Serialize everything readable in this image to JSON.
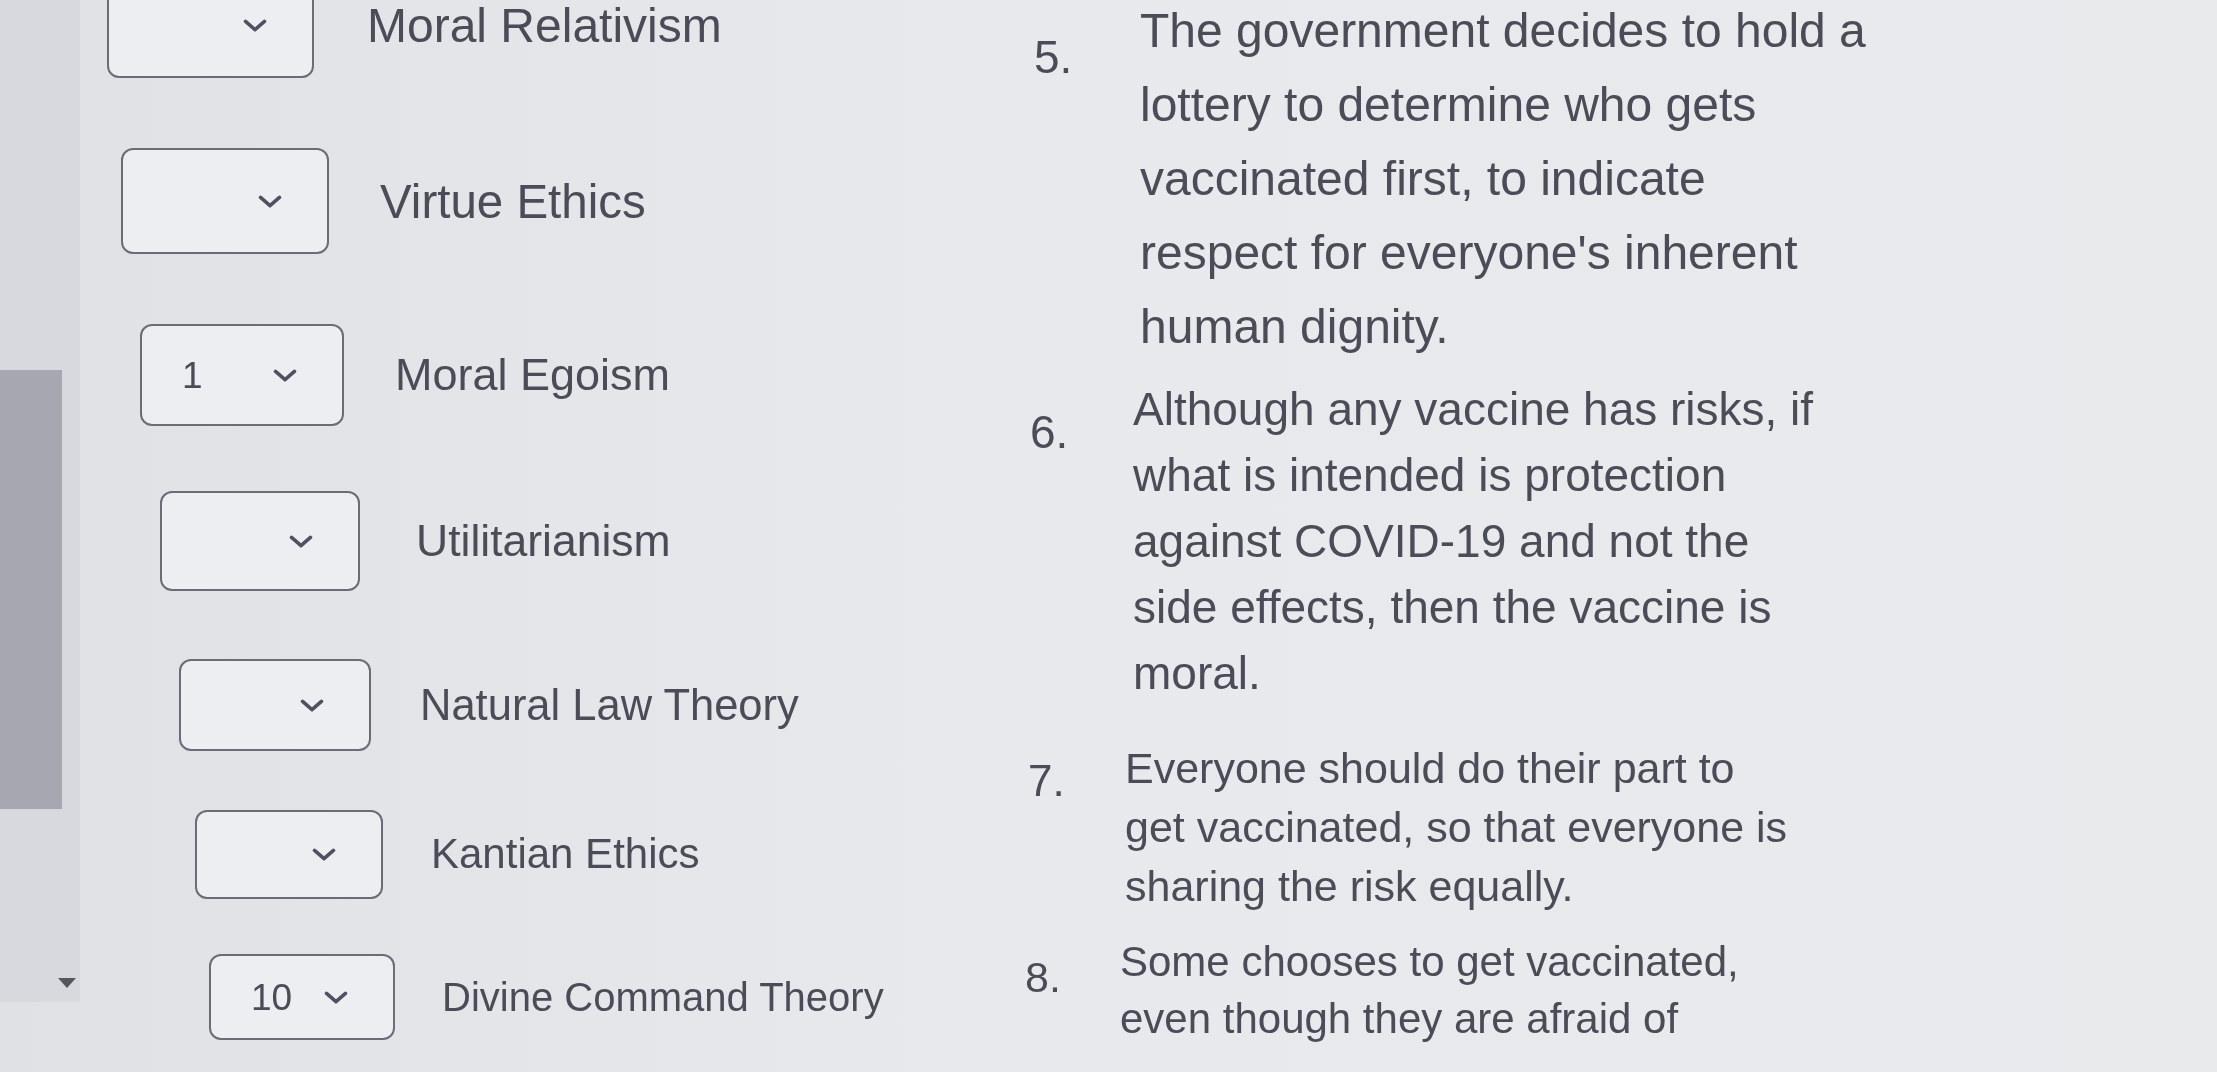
{
  "choices": [
    {
      "label": "Moral Relativism"
    },
    {
      "label": "Virtue Ethics"
    },
    {
      "value": "1",
      "label": "Moral Egoism"
    },
    {
      "label": "Utilitarianism"
    },
    {
      "label": "Natural Law Theory"
    },
    {
      "label": "Kantian Ethics"
    },
    {
      "value": "10",
      "label": "Divine Command Theory"
    }
  ],
  "statements": [
    {
      "number": "5.",
      "text": "The government decides to hold a lottery to determine who gets vaccinated first, to indicate respect for everyone's inherent human dignity."
    },
    {
      "number": "6.",
      "text": "Although any vaccine has risks, if what is intended is protection against COVID-19 and not the side effects, then the vaccine is moral."
    },
    {
      "number": "7.",
      "text": "Everyone should do their part to get vaccinated, so that everyone is sharing the risk equally."
    },
    {
      "number": "8.",
      "text": "Some chooses to get vaccinated, even though they are afraid of"
    }
  ]
}
